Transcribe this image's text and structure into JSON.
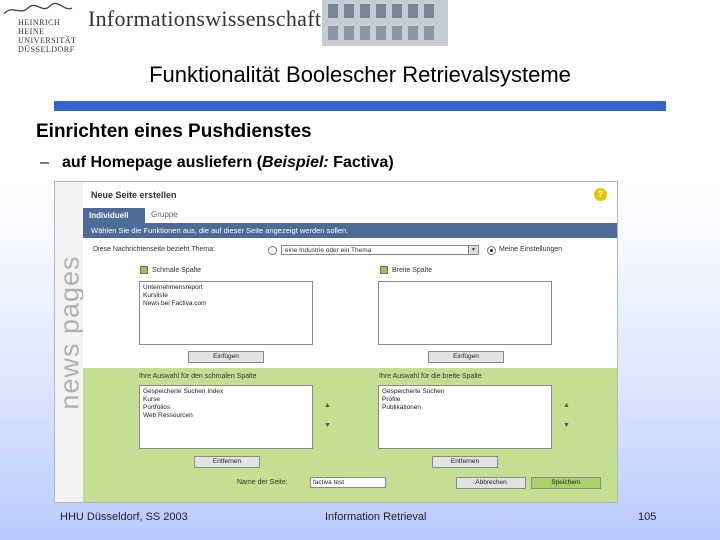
{
  "header": {
    "logo_lines": [
      "HEINRICH HEINE",
      "UNIVERSITÄT",
      "DÜSSELDORF"
    ],
    "brand": "Informationswissenschaft"
  },
  "slide": {
    "title": "Funktionalität Boolescher Retrievalsysteme",
    "heading": "Einrichten eines Pushdienstes",
    "bullet_dash": "–",
    "bullet_pre": "auf Homepage ausliefern (",
    "bullet_italic": "Beispiel:",
    "bullet_post": " Factiva)"
  },
  "screenshot": {
    "sidebar_text": "news pages",
    "panel_title": "Neue Seite erstellen",
    "help_symbol": "?",
    "tabs": {
      "active": "Individuell",
      "inactive": "Gruppe"
    },
    "instruction": "Wählen Sie die Funktionen aus, die auf dieser Seite angezeigt werden sollen.",
    "topic_label": "Diese Nachrichtenseite bezieht Thema:",
    "topic_select": "eine Industrie oder ein Thema",
    "my_settings": "Meine Einstellungen",
    "narrow_col_label": "Schmale Spalte",
    "wide_col_label": "Breite Spalte",
    "narrow_available": [
      "Unternehmensreport",
      "Kursliste",
      "News bei Factiva.com"
    ],
    "wide_available": [],
    "insert_label": "Einfügen",
    "narrow_selected_label": "Ihre Auswahl für den schmalen Spalte",
    "wide_selected_label": "Ihre Auswahl für die breite Spalte",
    "narrow_selected": [
      "Gespeicherte Suchen Index",
      "Kurse",
      "Portfolios",
      "Web Ressourcen"
    ],
    "wide_selected": [
      "Gespeicherte Suchen",
      "Profile",
      "Publikationen"
    ],
    "remove_label": "Entfernen",
    "up_arrow": "▲",
    "down_arrow": "▼",
    "page_name_label": "Name der Seite:",
    "page_name_value": "factiva test",
    "cancel_label": "Abbrechen",
    "save_label": "Speichern",
    "colors": {
      "blue_bar": "#3366cc",
      "tab_blue": "#4d6b99",
      "green_section": "#c5df92",
      "green_button": "#a9d06a"
    }
  },
  "footer": {
    "left": "HHU Düsseldorf, SS 2003",
    "center": "Information Retrieval",
    "page": "105"
  }
}
